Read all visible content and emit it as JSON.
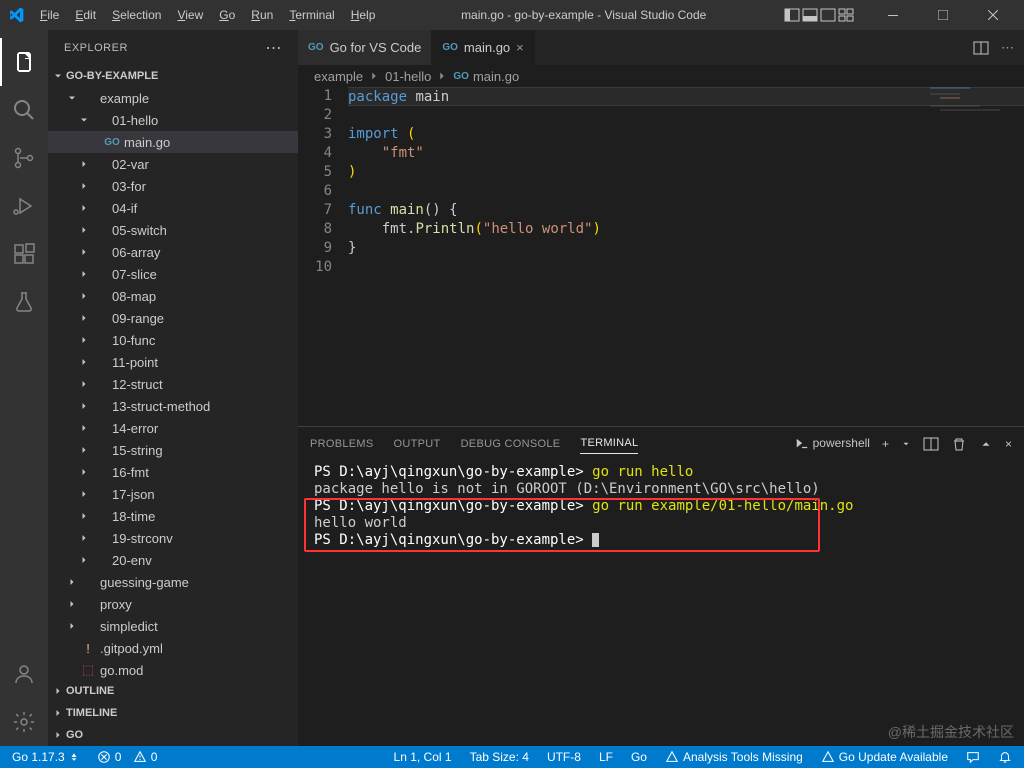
{
  "title": "main.go - go-by-example - Visual Studio Code",
  "menu": [
    "File",
    "Edit",
    "Selection",
    "View",
    "Go",
    "Run",
    "Terminal",
    "Help"
  ],
  "sidebar": {
    "title": "EXPLORER",
    "project": "GO-BY-EXAMPLE",
    "tree": {
      "example": "example",
      "hello": "01-hello",
      "maingo": "main.go",
      "folders": [
        "02-var",
        "03-for",
        "04-if",
        "05-switch",
        "06-array",
        "07-slice",
        "08-map",
        "09-range",
        "10-func",
        "11-point",
        "12-struct",
        "13-struct-method",
        "14-error",
        "15-string",
        "16-fmt",
        "17-json",
        "18-time",
        "19-strconv",
        "20-env"
      ],
      "guessing": "guessing-game",
      "proxy": "proxy",
      "simpledict": "simpledict",
      "gitpod": ".gitpod.yml",
      "gomod": "go.mod"
    },
    "sections": [
      "OUTLINE",
      "TIMELINE",
      "GO"
    ]
  },
  "tabs": [
    {
      "label": "Go for VS Code",
      "active": false
    },
    {
      "label": "main.go",
      "active": true
    }
  ],
  "breadcrumb": [
    "example",
    "01-hello",
    "main.go"
  ],
  "code": {
    "lines": 10,
    "l1_kw": "package",
    "l1_name": " main",
    "l3_kw": "import",
    "l3_paren": " (",
    "l4": "    \"fmt\"",
    "l5": ")",
    "l7_kw": "func",
    "l7_fn": " main",
    "l7_rest": "() {",
    "l8_pre": "    fmt.",
    "l8_fn": "Println",
    "l8_p1": "(",
    "l8_str": "\"hello world\"",
    "l8_p2": ")",
    "l9": "}"
  },
  "panel": {
    "tabs": [
      "PROBLEMS",
      "OUTPUT",
      "DEBUG CONSOLE",
      "TERMINAL"
    ],
    "shell": "powershell",
    "lines": [
      {
        "prompt": "PS D:\\ayj\\qingxun\\go-by-example> ",
        "cmd": "go run hello"
      },
      {
        "text": "package hello is not in GOROOT (D:\\Environment\\GO\\src\\hello)"
      },
      {
        "prompt": "PS D:\\ayj\\qingxun\\go-by-example> ",
        "cmd": "go run example/01-hello/main.go"
      },
      {
        "text": "hello world"
      },
      {
        "prompt": "PS D:\\ayj\\qingxun\\go-by-example> ",
        "cursor": true
      }
    ]
  },
  "status": {
    "go_version": "Go 1.17.3",
    "errors": "0",
    "warnings": "0",
    "ln": "Ln 1, Col 1",
    "tab": "Tab Size: 4",
    "encoding": "UTF-8",
    "eol": "LF",
    "lang": "Go",
    "analysis": "Analysis Tools Missing",
    "update": "Go Update Available"
  },
  "watermark": "@稀土掘金技术社区"
}
